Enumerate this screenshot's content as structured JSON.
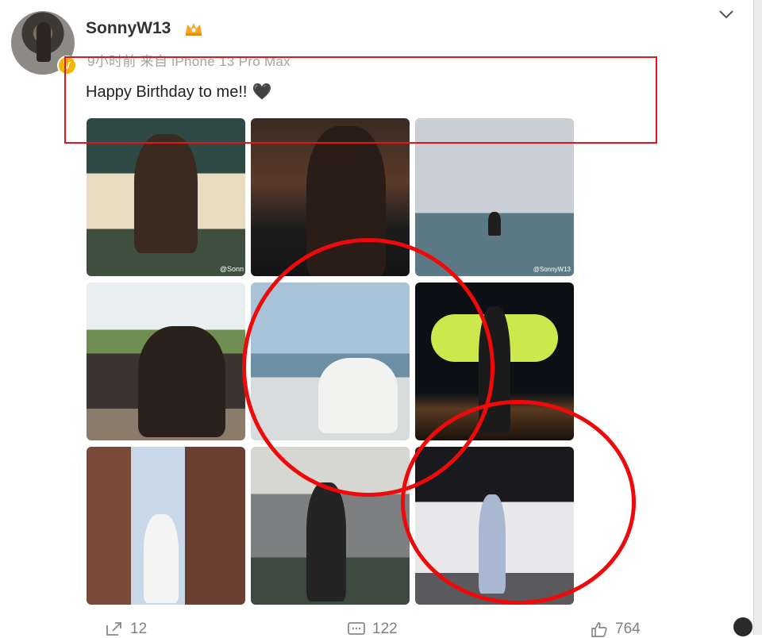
{
  "post": {
    "username": "SonnyW13",
    "meta": "9小时前  来自 iPhone 13 Pro Max",
    "text": "Happy Birthday to me!!",
    "emoji": "🖤",
    "verify_badge": "V",
    "photos": [
      {
        "watermark": "@Sonn"
      },
      {
        "watermark": ""
      },
      {
        "watermark": "@SonnyW13"
      },
      {
        "watermark": ""
      },
      {
        "watermark": ""
      },
      {
        "watermark": ""
      },
      {
        "watermark": ""
      },
      {
        "watermark": ""
      },
      {
        "watermark": ""
      }
    ]
  },
  "actions": {
    "repost_count": "12",
    "comment_count": "122",
    "like_count": "764"
  },
  "icons": {
    "more": "chevron-down-icon",
    "repost": "repost-icon",
    "comment": "comment-icon",
    "like": "thumbs-up-icon",
    "vip": "crown-icon"
  },
  "colors": {
    "annotation": "#e3141b",
    "meta_text": "#a3a3a3",
    "verify": "#f5b400"
  }
}
